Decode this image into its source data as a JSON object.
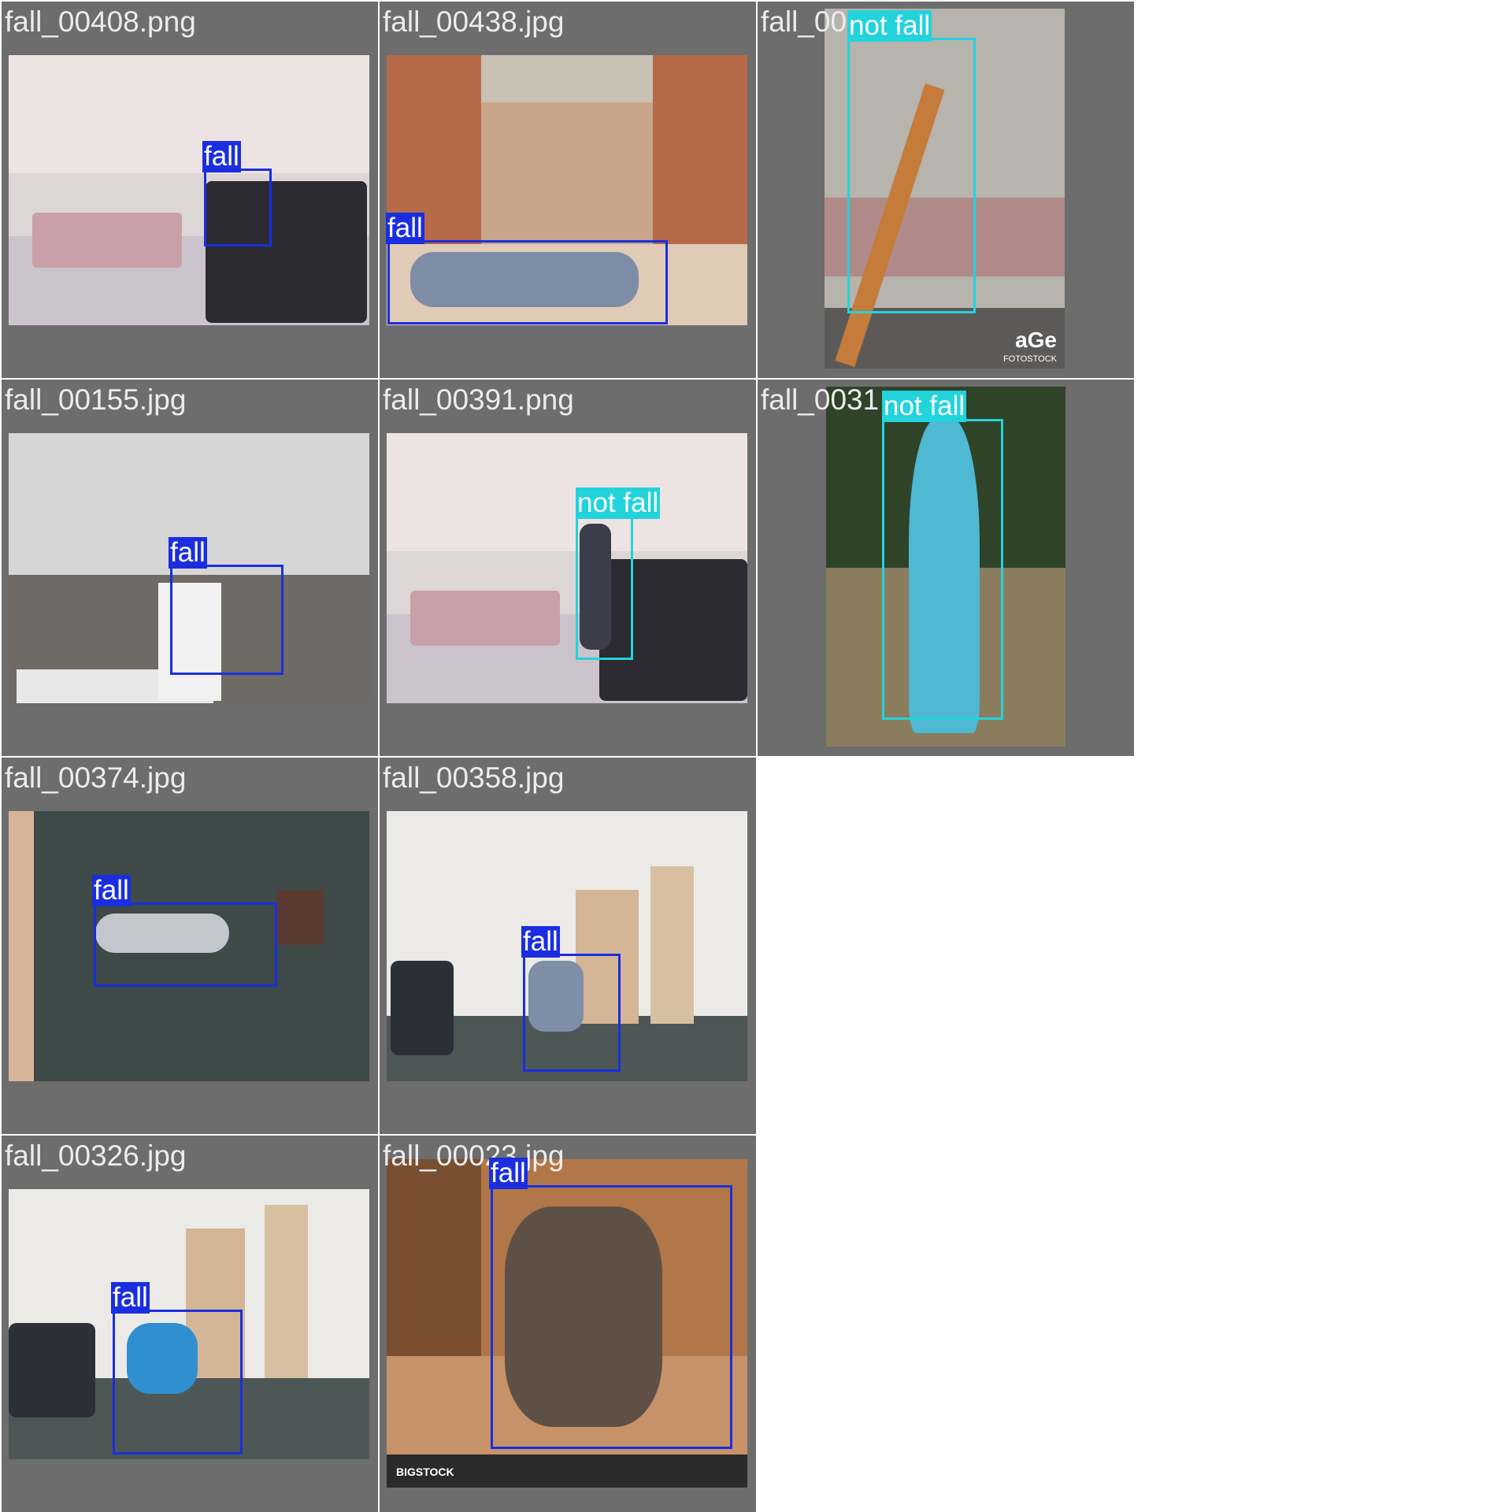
{
  "tiles": [
    {
      "filename": "fall_00408.png",
      "labels": [
        "fall"
      ]
    },
    {
      "filename": "fall_00438.jpg",
      "labels": [
        "fall"
      ]
    },
    {
      "filename": "fall_00",
      "labels": [
        "not fall"
      ]
    },
    {
      "filename": "fall_00155.jpg",
      "labels": [
        "fall"
      ]
    },
    {
      "filename": "fall_00391.png",
      "labels": [
        "not fall"
      ]
    },
    {
      "filename": "fall_0031",
      "labels": [
        "not fall"
      ]
    },
    {
      "filename": "fall_00374.jpg",
      "labels": [
        "fall"
      ]
    },
    {
      "filename": "fall_00358.jpg",
      "labels": [
        "fall"
      ]
    },
    {
      "filename": "fall_00326.jpg",
      "labels": [
        "fall"
      ]
    },
    {
      "filename": "fall_00023.jpg",
      "labels": [
        "fall"
      ]
    }
  ],
  "watermarks": {
    "tile3": "aGe",
    "tile3_sub": "FOTOSTOCK",
    "tile10": "BIGSTOCK"
  },
  "colors": {
    "fall": "#1a2ee0",
    "not_fall": "#22d3dc",
    "tile_bg": "#6d6d6d"
  }
}
